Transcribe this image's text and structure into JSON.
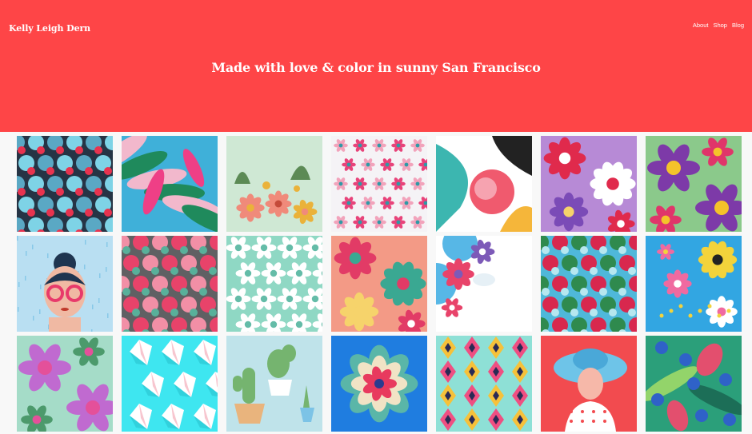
{
  "site": {
    "brand": "Kelly Leigh Dern",
    "tagline": "Made with love & color in sunny San Francisco",
    "accent": "#fe4547"
  },
  "nav": {
    "items": [
      {
        "label": "About"
      },
      {
        "label": "Shop"
      },
      {
        "label": "Blog"
      }
    ]
  },
  "gallery": {
    "tiles": [
      {
        "name": "navy-floral-pattern",
        "bg": "#263445",
        "c1": "#7ed3e6",
        "c2": "#e8334f",
        "c3": "#5aa8c4",
        "style": "blobs"
      },
      {
        "name": "tropical-leaves-pattern",
        "bg": "#3fb0d9",
        "c1": "#1f8a5c",
        "c2": "#ef3f86",
        "c3": "#f2b8cc",
        "style": "leaves"
      },
      {
        "name": "coral-bouquet-pattern",
        "bg": "#cfe8d4",
        "c1": "#f08a7a",
        "c2": "#eab23a",
        "c3": "#5c8a55",
        "style": "bouquet"
      },
      {
        "name": "ditsy-rose-pattern",
        "bg": "#f5f3f6",
        "c1": "#e8437a",
        "c2": "#2e9aa6",
        "c3": "#f2a3bb",
        "style": "ditsy"
      },
      {
        "name": "abstract-bloom-pattern",
        "bg": "#ffffff",
        "c1": "#f05a6e",
        "c2": "#3cb6b0",
        "c3": "#f5b63a",
        "style": "abstract"
      },
      {
        "name": "red-purple-flower-pattern",
        "bg": "#b78ad6",
        "c1": "#e02a4c",
        "c2": "#ffffff",
        "c3": "#7b4bb7",
        "style": "bigflowers"
      },
      {
        "name": "purple-lily-pattern",
        "bg": "#8bc98b",
        "c1": "#7d3aa8",
        "c2": "#f4c32a",
        "c3": "#e0356a",
        "style": "lily"
      },
      {
        "name": "girl-with-glasses-illustration",
        "bg": "#b9dff2",
        "c1": "#e83a6b",
        "c2": "#1f3550",
        "c3": "#f0b9a3",
        "style": "face"
      },
      {
        "name": "grey-rose-pattern",
        "bg": "#606063",
        "c1": "#e8436a",
        "c2": "#58b09a",
        "c3": "#f28fa6",
        "style": "blobs"
      },
      {
        "name": "white-lily-mint-pattern",
        "bg": "#8fd8c4",
        "c1": "#ffffff",
        "c2": "#f2f8f6",
        "c3": "#64bca8",
        "style": "whitelily"
      },
      {
        "name": "coral-floral-pattern",
        "bg": "#f39a86",
        "c1": "#e23b66",
        "c2": "#3aa892",
        "c3": "#f6d36b",
        "style": "bigflowers"
      },
      {
        "name": "blue-corner-bouquet",
        "bg": "#ffffff",
        "c1": "#57b7e6",
        "c2": "#e8436a",
        "c3": "#7d5ab8",
        "style": "corner"
      },
      {
        "name": "turquoise-rose-pattern",
        "bg": "#4fb8da",
        "c1": "#d8284e",
        "c2": "#b6e7ef",
        "c3": "#2f8a4e",
        "style": "blobs"
      },
      {
        "name": "sky-blue-garden-pattern",
        "bg": "#32a6e2",
        "c1": "#f3d33b",
        "c2": "#f06aa0",
        "c3": "#ffffff",
        "style": "garden"
      },
      {
        "name": "pink-lily-mint-pattern",
        "bg": "#a5dcc8",
        "c1": "#c06ad0",
        "c2": "#e4509a",
        "c3": "#4c9a6c",
        "style": "lily"
      },
      {
        "name": "crystal-gem-pattern",
        "bg": "#3ee6f0",
        "c1": "#ffffff",
        "c2": "#f7c6cf",
        "c3": "#1aa8b8",
        "style": "gems"
      },
      {
        "name": "cactus-pots-illustration",
        "bg": "#bfe3ea",
        "c1": "#75b46f",
        "c2": "#e9b47d",
        "c3": "#ffffff",
        "style": "cactus"
      },
      {
        "name": "succulent-illustration",
        "bg": "#1f7de0",
        "c1": "#f1e3c5",
        "c2": "#e83a5e",
        "c3": "#5ab6a8",
        "style": "succulent"
      },
      {
        "name": "geometric-diamond-pattern",
        "bg": "#8ee0d6",
        "c1": "#ef4f82",
        "c2": "#f6c13a",
        "c3": "#2a2a55",
        "style": "diamonds"
      },
      {
        "name": "woman-in-hat-illustration",
        "bg": "#f24b4f",
        "c1": "#6ec4e8",
        "c2": "#f6b8a9",
        "c3": "#ffffff",
        "style": "hat"
      },
      {
        "name": "blueberry-leaf-pattern",
        "bg": "#2b9f7a",
        "c1": "#2f62c8",
        "c2": "#e34f6e",
        "c3": "#93d46a",
        "style": "berries"
      }
    ]
  }
}
